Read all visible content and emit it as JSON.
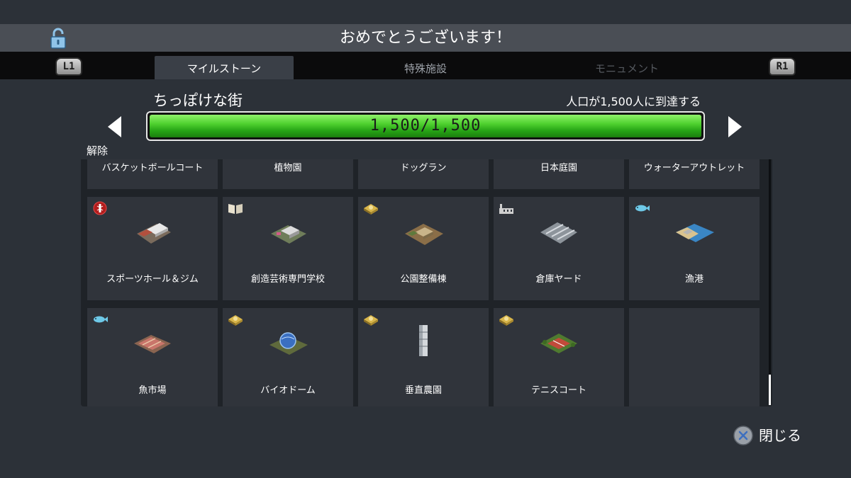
{
  "header": {
    "title": "おめでとうございます！"
  },
  "shoulder_buttons": {
    "left": "L1",
    "right": "R1"
  },
  "tabs": [
    {
      "label": "マイルストーン",
      "state": "active"
    },
    {
      "label": "特殊施設",
      "state": "inactive"
    },
    {
      "label": "モニュメント",
      "state": "disabled"
    }
  ],
  "milestone": {
    "name": "ちっぽけな街",
    "goal": "人口が1,500人に到達する",
    "progress_text": "1,500/1,500",
    "progress_fraction": 1.0
  },
  "section_label": "解除",
  "unlocks": {
    "top_row": [
      {
        "label": "バスケットボールコート"
      },
      {
        "label": "植物園"
      },
      {
        "label": "ドッグラン"
      },
      {
        "label": "日本庭園"
      },
      {
        "label": "ウォーターアウトレット"
      }
    ],
    "middle_row": [
      {
        "label": "スポーツホール＆ジム",
        "badge": "health-icon"
      },
      {
        "label": "創造芸術専門学校",
        "badge": "book-icon"
      },
      {
        "label": "公園整備棟",
        "badge": "park-icon"
      },
      {
        "label": "倉庫ヤード",
        "badge": "factory-icon"
      },
      {
        "label": "漁港",
        "badge": "fish-icon"
      }
    ],
    "bottom_row": [
      {
        "label": "魚市場",
        "badge": "fish-icon"
      },
      {
        "label": "バイオドーム",
        "badge": "park-icon"
      },
      {
        "label": "垂直農園",
        "badge": "park-icon"
      },
      {
        "label": "テニスコート",
        "badge": "park-icon"
      }
    ]
  },
  "footer": {
    "close_label": "閉じる"
  },
  "colors": {
    "progress_green": "#4fd12f",
    "background": "#2c3138"
  }
}
